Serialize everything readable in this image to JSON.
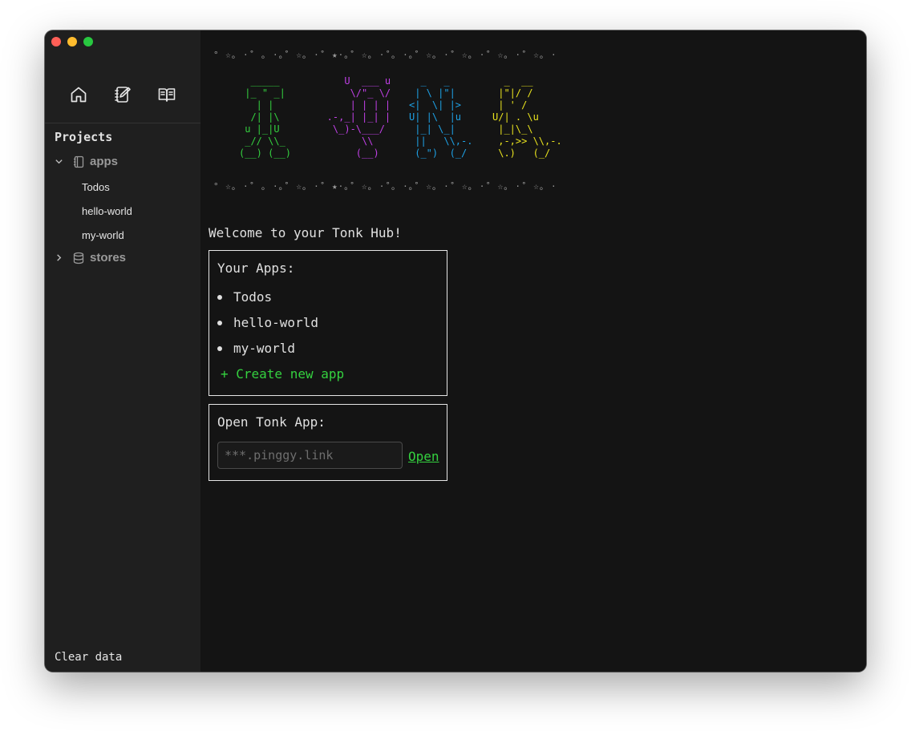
{
  "sidebar": {
    "nav": [
      {
        "icon": "home-icon"
      },
      {
        "icon": "notebook-edit-icon"
      },
      {
        "icon": "open-book-icon"
      }
    ],
    "projects_heading": "Projects",
    "folders": [
      {
        "label": "apps",
        "expanded": true,
        "items": [
          "Todos",
          "hello-world",
          "my-world"
        ]
      },
      {
        "label": "stores",
        "expanded": false
      }
    ],
    "clear_data": "Clear data"
  },
  "banner": {
    "stars": "° ☆｡ ·˚ ｡ ·｡˚ ☆｡ ·˚ ★·｡˚ ☆｡ ·˚｡ ·｡˚ ☆｡ ·˚ ☆｡ ·˚ ☆｡ ·˚ ☆｡ ·",
    "colors": {
      "t": "#34d13f",
      "o": "#c040e6",
      "n": "#1ea2e6",
      "k": "#e8e21e"
    }
  },
  "main": {
    "welcome": "Welcome to your Tonk Hub!",
    "apps_box": {
      "title": "Your Apps:",
      "apps": [
        "Todos",
        "hello-world",
        "my-world"
      ],
      "create_label": "+ Create new app"
    },
    "open_box": {
      "title": "Open Tonk App:",
      "placeholder": "***.pinggy.link",
      "open_label": "Open"
    }
  }
}
